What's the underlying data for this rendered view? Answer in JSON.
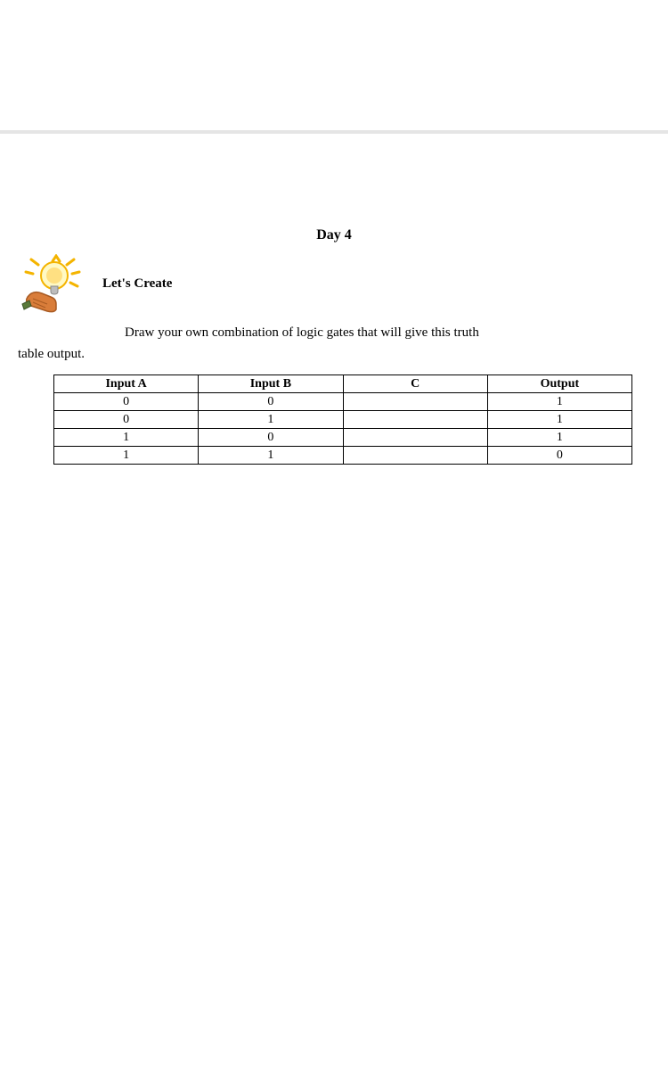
{
  "heading": "Day 4",
  "section_label": "Let's Create",
  "instruction_line1": "Draw your own combination of logic gates that will give this truth",
  "instruction_line2": "table output.",
  "table": {
    "headers": [
      "Input A",
      "Input B",
      "C",
      "Output"
    ],
    "rows": [
      [
        "0",
        "0",
        "",
        "1"
      ],
      [
        "0",
        "1",
        "",
        "1"
      ],
      [
        "1",
        "0",
        "",
        "1"
      ],
      [
        "1",
        "1",
        "",
        "0"
      ]
    ]
  }
}
